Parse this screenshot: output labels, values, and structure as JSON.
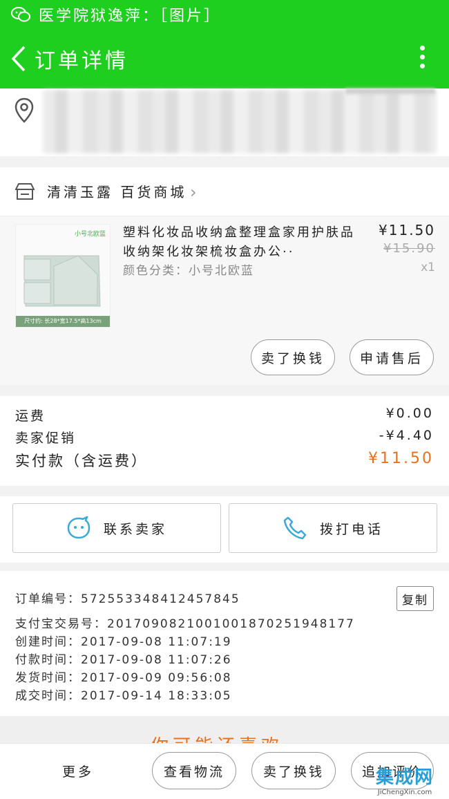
{
  "status_bar": {
    "text": "医学院狱逸萍：［图片］"
  },
  "header": {
    "title": "订单详情"
  },
  "shop": {
    "name": "清清玉露 百货商城"
  },
  "product": {
    "title": "塑料化妆品收纳盒整理盒家用护肤品收纳架化妆架梳妆盒办公··",
    "spec": "颜色分类：小号北欧蓝",
    "price": "¥11.50",
    "original_price": "¥15.90",
    "quantity": "x1",
    "image_tag": "小号北欧蓝",
    "image_caption": "尺寸约: 长28*宽17.5*高13cm",
    "buttons": {
      "refund": "卖了换钱",
      "after_sale": "申请售后"
    }
  },
  "fees": {
    "shipping_label": "运费",
    "shipping_value": "¥0.00",
    "promo_label": "卖家促销",
    "promo_value": "-¥4.40",
    "total_label": "实付款（含运费）",
    "total_value": "¥11.50"
  },
  "contact": {
    "seller": "联系卖家",
    "call": "拨打电话"
  },
  "order_info": {
    "order_no": "订单编号：572553348412457845",
    "alipay_no": "支付宝交易号：2017090821001001870251948177",
    "created": "创建时间：2017-09-08 11:07:19",
    "paid": "付款时间：2017-09-08 11:07:26",
    "shipped": "发货时间：2017-09-09 09:56:08",
    "closed": "成交时间：2017-09-14 18:33:05",
    "copy": "复制"
  },
  "banner": {
    "text": "你可能还喜欢"
  },
  "bottom_bar": {
    "more": "更多",
    "logistics": "查看物流",
    "sell": "卖了换钱",
    "review": "追加评价"
  },
  "watermark": {
    "logo": "集成网",
    "url": "JiChengXin.com"
  },
  "colors": {
    "brand_green": "#1fcf1f",
    "accent_orange": "#e8701a",
    "icon_blue": "#39a9d8"
  }
}
